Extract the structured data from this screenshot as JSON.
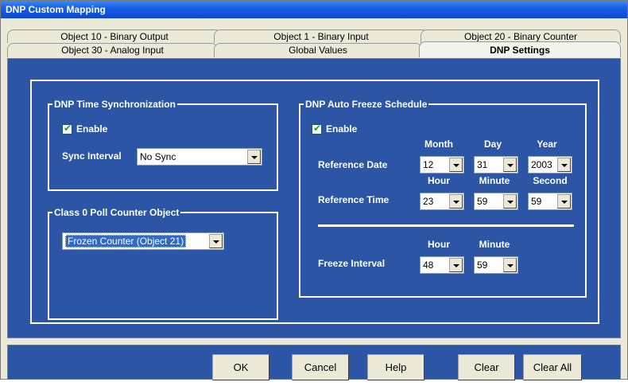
{
  "window": {
    "title": "DNP Custom Mapping"
  },
  "tabs": {
    "back": [
      {
        "label": "Object 10 - Binary Output"
      },
      {
        "label": "Object 1 - Binary Input"
      },
      {
        "label": "Object 20 - Binary Counter"
      }
    ],
    "front": [
      {
        "label": "Object 30 - Analog Input"
      },
      {
        "label": "Global Values"
      },
      {
        "label": "DNP Settings"
      }
    ],
    "active": "DNP Settings"
  },
  "time_sync": {
    "title": "DNP Time Synchronization",
    "enable_label": "Enable",
    "enable_checked": true,
    "sync_interval_label": "Sync Interval",
    "sync_interval_value": "No Sync"
  },
  "class0": {
    "title": "Class 0 Poll Counter Object",
    "value": "Frozen Counter (Object 21)"
  },
  "auto_freeze": {
    "title": "DNP Auto Freeze Schedule",
    "enable_label": "Enable",
    "enable_checked": true,
    "date_headers": {
      "month": "Month",
      "day": "Day",
      "year": "Year"
    },
    "reference_date_label": "Reference Date",
    "reference_date": {
      "month": "12",
      "day": "31",
      "year": "2003"
    },
    "time_headers": {
      "hour": "Hour",
      "minute": "Minute",
      "second": "Second"
    },
    "reference_time_label": "Reference Time",
    "reference_time": {
      "hour": "23",
      "minute": "59",
      "second": "59"
    },
    "interval_headers": {
      "hour": "Hour",
      "minute": "Minute"
    },
    "freeze_interval_label": "Freeze Interval",
    "freeze_interval": {
      "hour": "48",
      "minute": "59"
    }
  },
  "buttons": {
    "ok": "OK",
    "cancel": "Cancel",
    "help": "Help",
    "clear": "Clear",
    "clear_all": "Clear All"
  }
}
